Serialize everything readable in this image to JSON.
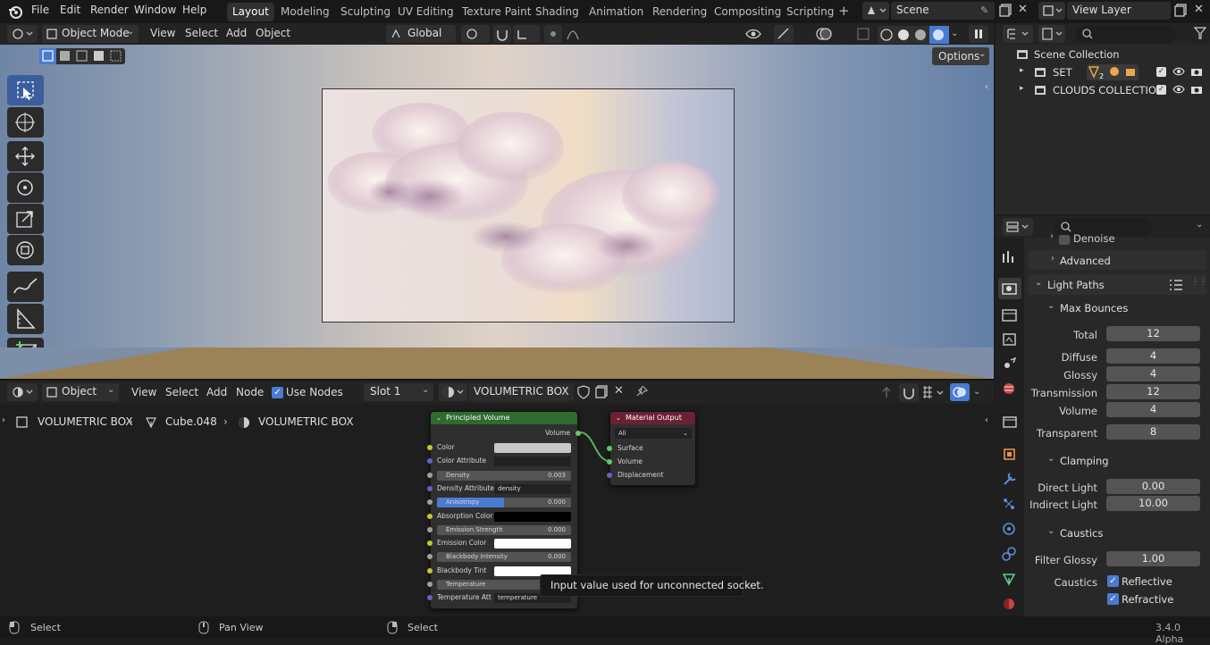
{
  "menu": [
    "File",
    "Edit",
    "Render",
    "Window",
    "Help"
  ],
  "workspaces": [
    "Layout",
    "Modeling",
    "Sculpting",
    "UV Editing",
    "Texture Paint",
    "Shading",
    "Animation",
    "Rendering",
    "Compositing",
    "Scripting"
  ],
  "active_workspace": "Layout",
  "scene": {
    "name": "Scene",
    "view_layer": "View Layer"
  },
  "viewport_header": {
    "mode": "Object Mode",
    "menus": [
      "View",
      "Select",
      "Add",
      "Object"
    ],
    "transform": "Global",
    "options": "Options"
  },
  "node_header": {
    "type": "Object",
    "menus": [
      "View",
      "Select",
      "Add",
      "Node"
    ],
    "use_nodes": "Use Nodes",
    "slot": "Slot 1",
    "material": "VOLUMETRIC BOX"
  },
  "breadcrumb": [
    "VOLUMETRIC BOX",
    "Cube.048",
    "VOLUMETRIC BOX"
  ],
  "node_principled": {
    "title": "Principled Volume",
    "output": "Volume",
    "inputs": [
      {
        "label": "Color",
        "kind": "color",
        "value": "",
        "color": "#c8c8c8"
      },
      {
        "label": "Color Attribute",
        "kind": "text",
        "value": ""
      },
      {
        "label": "Density",
        "kind": "slider",
        "value": "0.003",
        "fill": 0
      },
      {
        "label": "Density Attribute",
        "kind": "text",
        "value": "density"
      },
      {
        "label": "Anisotropy",
        "kind": "slider",
        "value": "0.000",
        "fill": 0.5
      },
      {
        "label": "Absorption Color",
        "kind": "color",
        "value": "",
        "color": "#000000"
      },
      {
        "label": "Emission Strength",
        "kind": "slider",
        "value": "0.000",
        "fill": 0
      },
      {
        "label": "Emission Color",
        "kind": "color",
        "value": "",
        "color": "#ffffff"
      },
      {
        "label": "Blackbody Intensity",
        "kind": "slider",
        "value": "0.000",
        "fill": 0
      },
      {
        "label": "Blackbody Tint",
        "kind": "color",
        "value": "",
        "color": "#ffffff"
      },
      {
        "label": "Temperature",
        "kind": "slider",
        "value": "1",
        "fill": 0
      },
      {
        "label": "Temperature Att",
        "kind": "text",
        "value": "temperature"
      }
    ]
  },
  "node_output": {
    "title": "Material Output",
    "target": "All",
    "inputs": [
      "Surface",
      "Volume",
      "Displacement"
    ]
  },
  "tooltip": "Input value used for unconnected socket.",
  "outliner": {
    "root": "Scene Collection",
    "items": [
      {
        "name": "SET",
        "badge": "2"
      },
      {
        "name": "CLOUDS COLLECTION"
      }
    ]
  },
  "properties": {
    "partial_top": "Denoise",
    "advanced": "Advanced",
    "light_paths": "Light Paths",
    "max_bounces": "Max Bounces",
    "bounces": [
      {
        "label": "Total",
        "value": "12"
      },
      {
        "label": "Diffuse",
        "value": "4"
      },
      {
        "label": "Glossy",
        "value": "4"
      },
      {
        "label": "Transmission",
        "value": "12"
      },
      {
        "label": "Volume",
        "value": "4"
      },
      {
        "label": "Transparent",
        "value": "8"
      }
    ],
    "clamping": "Clamping",
    "clamp_rows": [
      {
        "label": "Direct Light",
        "value": "0.00"
      },
      {
        "label": "Indirect Light",
        "value": "10.00"
      }
    ],
    "caustics": "Caustics",
    "filter_glossy": {
      "label": "Filter Glossy",
      "value": "1.00"
    },
    "caustics_label": "Caustics",
    "reflective": "Reflective",
    "refractive": "Refractive"
  },
  "statusbar": {
    "items": [
      "Select",
      "Pan View",
      "Select"
    ],
    "version": "3.4.0 Alpha"
  }
}
